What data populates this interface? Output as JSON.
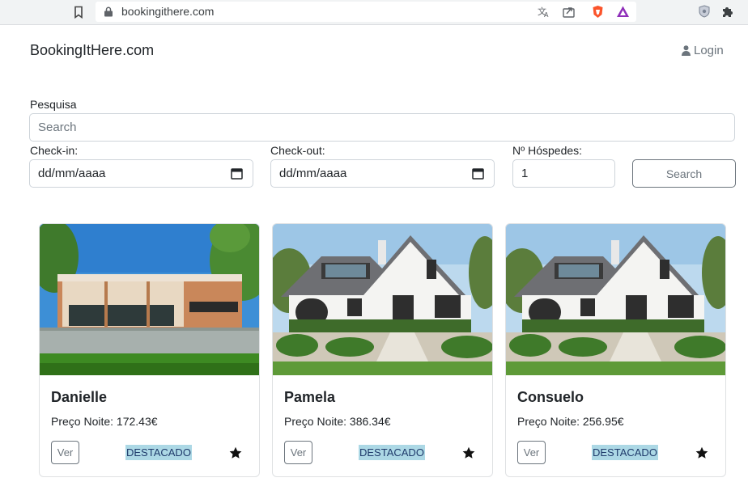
{
  "browser": {
    "url": "bookingithere.com"
  },
  "header": {
    "brand": "BookingItHere.com",
    "login_label": "Login"
  },
  "search": {
    "label": "Pesquisa",
    "placeholder": "Search",
    "checkin_label": "Check-in:",
    "checkin_value": "dd/mm/aaaa",
    "checkout_label": "Check-out:",
    "checkout_value": "dd/mm/aaaa",
    "guests_label": "Nº Hóspedes:",
    "guests_value": "1",
    "button_label": "Search"
  },
  "listings": [
    {
      "name": "Danielle",
      "price": "Preço Noite: 172.43€",
      "view_label": "Ver",
      "badge": "DESTACADO"
    },
    {
      "name": "Pamela",
      "price": "Preço Noite: 386.34€",
      "view_label": "Ver",
      "badge": "DESTACADO"
    },
    {
      "name": "Consuelo",
      "price": "Preço Noite: 256.95€",
      "view_label": "Ver",
      "badge": "DESTACADO"
    }
  ],
  "colors": {
    "badge_bg": "#acd8e5",
    "secondary": "#6c757d"
  }
}
